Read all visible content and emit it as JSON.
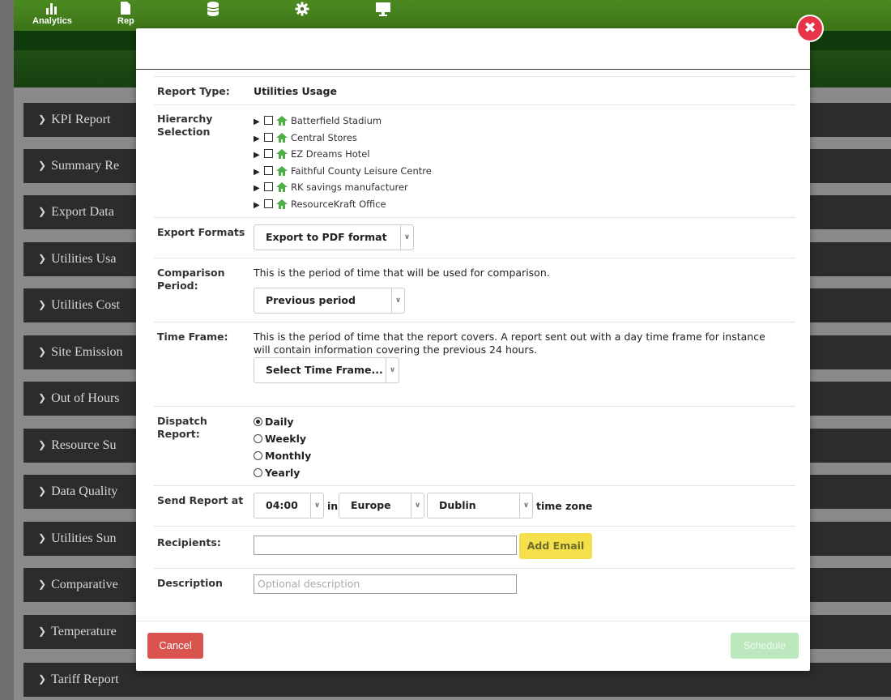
{
  "nav": {
    "items": [
      {
        "label": "Analytics",
        "icon": "bar-chart-icon"
      },
      {
        "label": "Rep",
        "icon": "document-icon"
      },
      {
        "label": "",
        "icon": "database-icon"
      },
      {
        "label": "",
        "icon": "gear-icon"
      },
      {
        "label": "",
        "icon": "monitor-icon"
      }
    ]
  },
  "panels": [
    {
      "label": "KPI Report"
    },
    {
      "label": "Summary Re"
    },
    {
      "label": "Export Data"
    },
    {
      "label": "Utilities Usa"
    },
    {
      "label": "Utilities Cost"
    },
    {
      "label": "Site Emission"
    },
    {
      "label": "Out of Hours"
    },
    {
      "label": "Resource Su"
    },
    {
      "label": "Data Quality"
    },
    {
      "label": "Utilities Sun"
    },
    {
      "label": "Comparative"
    },
    {
      "label": "Temperature"
    },
    {
      "label": "Tariff Report"
    }
  ],
  "modal": {
    "close_icon": "close-icon",
    "report_type": {
      "label": "Report Type:",
      "value": "Utilities Usage"
    },
    "hierarchy": {
      "label_line1": "Hierarchy",
      "label_line2": "Selection",
      "items": [
        {
          "name": "Batterfield Stadium"
        },
        {
          "name": "Central Stores"
        },
        {
          "name": "EZ Dreams Hotel"
        },
        {
          "name": "Faithful County Leisure Centre"
        },
        {
          "name": "RK savings manufacturer"
        },
        {
          "name": "ResourceKraft Office"
        }
      ]
    },
    "export_formats": {
      "label": "Export Formats",
      "selected": "Export to PDF format"
    },
    "comparison": {
      "label_line1": "Comparison",
      "label_line2": "Period:",
      "help": "This is the period of time that will be used for comparison.",
      "selected": "Previous period"
    },
    "time_frame": {
      "label": "Time Frame:",
      "help_line1": "This is the period of time that the report covers. A report sent out with a day time frame for instance",
      "help_line2": "will contain information covering the previous 24 hours.",
      "selected": "Select Time Frame..."
    },
    "dispatch": {
      "label_line1": "Dispatch",
      "label_line2": "Report:",
      "options": [
        {
          "label": "Daily",
          "checked": true
        },
        {
          "label": "Weekly",
          "checked": false
        },
        {
          "label": "Monthly",
          "checked": false
        },
        {
          "label": "Yearly",
          "checked": false
        }
      ]
    },
    "send_at": {
      "label": "Send Report at",
      "time": "04:00",
      "in_text": "in",
      "region": "Europe",
      "city": "Dublin",
      "tz_text": "time zone"
    },
    "recipients": {
      "label": "Recipients:",
      "value": "",
      "add_label": "Add Email"
    },
    "description": {
      "label": "Description",
      "placeholder": "Optional description"
    },
    "footer": {
      "cancel": "Cancel",
      "schedule": "Schedule"
    }
  },
  "colors": {
    "accent_green": "#4b8a20",
    "close_red": "#e8344a",
    "cancel_red": "#d9534f",
    "add_email_yellow": "#f5e04b",
    "schedule_disabled_green": "#bde8bd"
  }
}
